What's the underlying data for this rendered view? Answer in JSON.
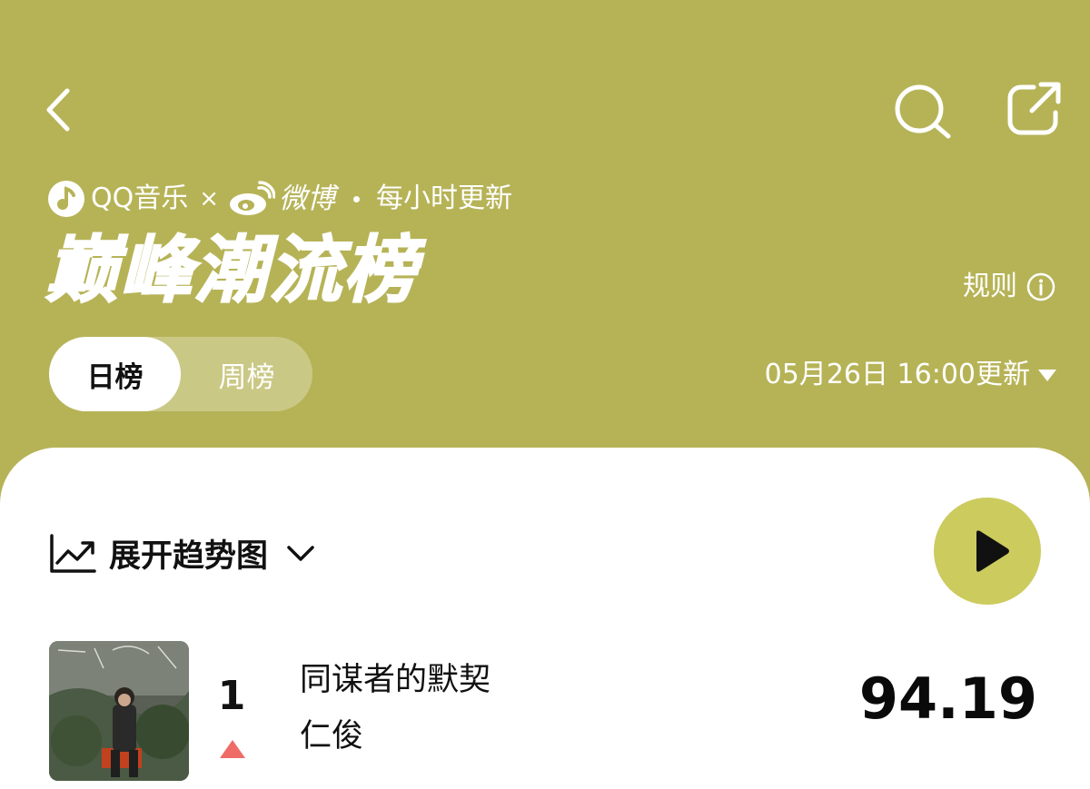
{
  "header": {
    "brand_qq": "QQ音乐",
    "brand_times": "×",
    "brand_weibo": "微博",
    "update_freq": "每小时更新",
    "title": "巅峰潮流榜",
    "rules_label": "规则"
  },
  "tabs": [
    {
      "label": "日榜",
      "active": true
    },
    {
      "label": "周榜",
      "active": false
    }
  ],
  "update_time": "05月26日 16:00更新",
  "trend_toggle_label": "展开趋势图",
  "colors": {
    "header_bg": "#b6b357",
    "play_button": "#cccb5e",
    "rank_up": "#ee6b66"
  },
  "icons": {
    "back": "chevron-left-icon",
    "search": "search-icon",
    "share": "share-icon",
    "info": "info-icon",
    "trend": "trend-chart-icon",
    "expand": "chevron-down-icon",
    "play": "play-icon",
    "rank_change": "arrow-up-icon"
  },
  "songs": [
    {
      "rank": "1",
      "title": "同谋者的默契",
      "artist": "仁俊",
      "score": "94.19",
      "trend": "up"
    }
  ]
}
